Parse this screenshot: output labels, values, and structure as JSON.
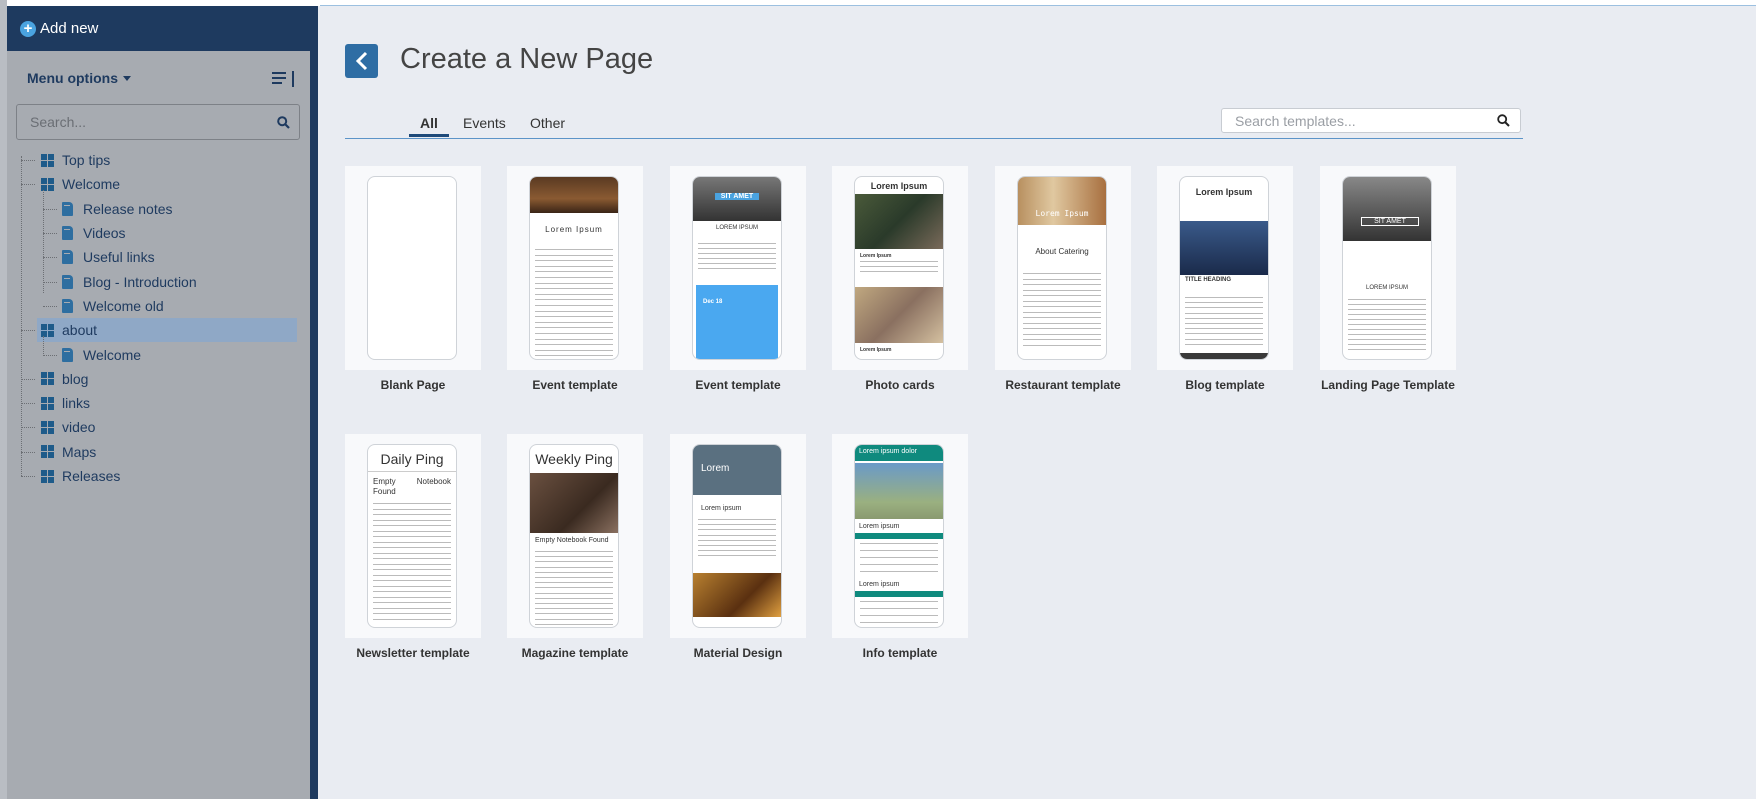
{
  "sidebar": {
    "add_label": "Add new",
    "menu_label": "Menu options",
    "search_placeholder": "Search...",
    "tree": [
      {
        "label": "Top tips",
        "level": 0,
        "type": "folder"
      },
      {
        "label": "Welcome",
        "level": 0,
        "type": "folder"
      },
      {
        "label": "Release notes",
        "level": 1,
        "type": "page"
      },
      {
        "label": "Videos",
        "level": 1,
        "type": "page"
      },
      {
        "label": "Useful links",
        "level": 1,
        "type": "page"
      },
      {
        "label": "Blog - Introduction",
        "level": 1,
        "type": "page"
      },
      {
        "label": "Welcome old",
        "level": 1,
        "type": "page"
      },
      {
        "label": "about",
        "level": 0,
        "type": "folder",
        "selected": true
      },
      {
        "label": "Welcome",
        "level": 1,
        "type": "page"
      },
      {
        "label": "blog",
        "level": 0,
        "type": "folder"
      },
      {
        "label": "links",
        "level": 0,
        "type": "folder"
      },
      {
        "label": "video",
        "level": 0,
        "type": "folder"
      },
      {
        "label": "Maps",
        "level": 0,
        "type": "folder"
      },
      {
        "label": "Releases",
        "level": 0,
        "type": "folder"
      }
    ]
  },
  "main": {
    "title": "Create a New Page",
    "tabs": [
      "All",
      "Events",
      "Other"
    ],
    "active_tab": "All",
    "search_placeholder": "Search templates..."
  },
  "templates": [
    {
      "name": "Blank Page",
      "preview": "blank"
    },
    {
      "name": "Event template",
      "preview": "event1",
      "heading": "Lorem Ipsum"
    },
    {
      "name": "Event template",
      "preview": "event2",
      "banner": "SIT AMET",
      "heading": "LOREM IPSUM",
      "date": "Dec 18"
    },
    {
      "name": "Photo cards",
      "preview": "photo",
      "heading": "Lorem Ipsum",
      "sub": "Lorem Ipsum"
    },
    {
      "name": "Restaurant template",
      "preview": "restaurant",
      "banner": "Lorem Ipsum",
      "heading": "About Catering"
    },
    {
      "name": "Blog template",
      "preview": "blog",
      "heading": "Lorem Ipsum",
      "sub": "TITLE HEADING"
    },
    {
      "name": "Landing Page Template",
      "preview": "landing",
      "banner": "SIT AMET",
      "heading": "LOREM IPSUM"
    },
    {
      "name": "Newsletter template",
      "preview": "newsletter",
      "heading": "Daily Ping",
      "sub": "Empty Found",
      "side": "Notebook"
    },
    {
      "name": "Magazine template",
      "preview": "magazine",
      "heading": "Weekly Ping",
      "sub": "Empty Notebook Found"
    },
    {
      "name": "Material Design",
      "preview": "material",
      "banner": "Lorem",
      "heading": "Lorem ipsum"
    },
    {
      "name": "Info template",
      "preview": "info",
      "banner": "Lorem ipsum dolor",
      "heading": "Lorem ipsum",
      "sub": "Lorem ipsum"
    }
  ],
  "colors": {
    "navy": "#1e3a5f",
    "accent": "#2e6da4",
    "teal": "#0f8a7e",
    "sidebar": "#a7abb1"
  }
}
